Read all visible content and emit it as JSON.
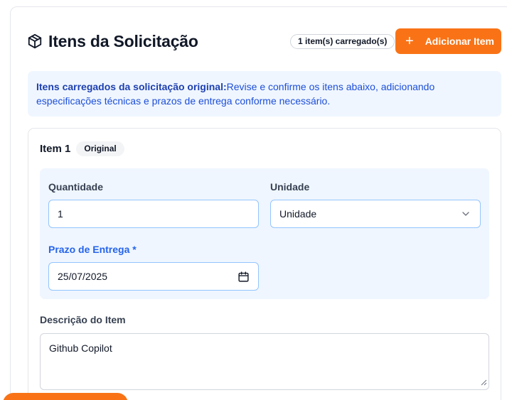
{
  "header": {
    "title": "Itens da Solicitação",
    "count_badge": "1 item(s) carregado(s)",
    "add_button": "Adicionar Item"
  },
  "info": {
    "bold": "Itens carregados da solicitação original:",
    "text": "Revise e confirme os itens abaixo, adicionando especificações técnicas e prazos de entrega conforme necessário."
  },
  "item": {
    "title": "Item 1",
    "tag": "Original",
    "quantity_label": "Quantidade",
    "quantity_value": "1",
    "unit_label": "Unidade",
    "unit_value": "Unidade",
    "deadline_label": "Prazo de Entrega *",
    "deadline_value": "25/07/2025",
    "description_label": "Descrição do Item",
    "description_value": "Github Copilot"
  },
  "colors": {
    "accent": "#f97316",
    "info_bg": "#eff6ff",
    "info_text": "#1d4ed8"
  }
}
